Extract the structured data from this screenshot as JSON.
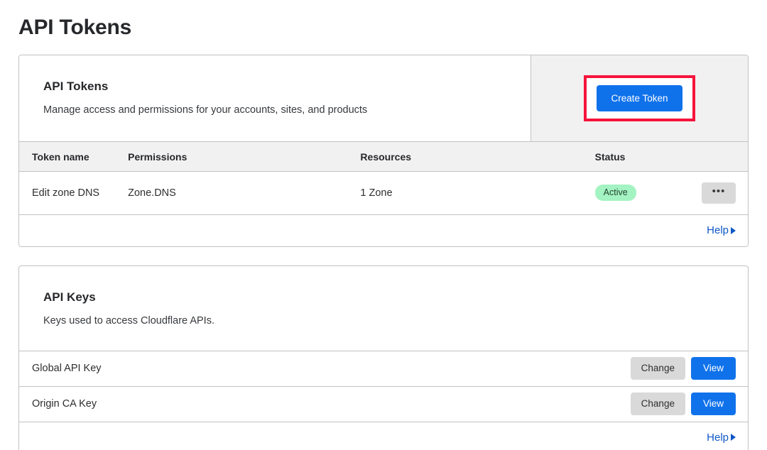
{
  "page": {
    "title": "API Tokens"
  },
  "tokens_card": {
    "header": {
      "title": "API Tokens",
      "subtitle": "Manage access and permissions for your accounts, sites, and products",
      "create_button": "Create Token"
    },
    "table": {
      "columns": [
        "Token name",
        "Permissions",
        "Resources",
        "Status",
        ""
      ],
      "rows": [
        {
          "name": "Edit zone DNS",
          "permissions": "Zone.DNS",
          "resources": "1 Zone",
          "status": "Active",
          "menu": "•••"
        }
      ]
    },
    "help_label": "Help"
  },
  "keys_card": {
    "header": {
      "title": "API Keys",
      "subtitle": "Keys used to access Cloudflare APIs."
    },
    "rows": [
      {
        "label": "Global API Key",
        "change_label": "Change",
        "view_label": "View"
      },
      {
        "label": "Origin CA Key",
        "change_label": "Change",
        "view_label": "View"
      }
    ],
    "help_label": "Help"
  },
  "colors": {
    "primary_blue": "#1072eb",
    "link_blue": "#0d57c6",
    "badge_green": "#a4f3c2",
    "highlight_red": "#f5143c",
    "panel_gray": "#f1f1f1",
    "border_gray": "#c2c2c2",
    "secondary_button_gray": "#d9d9d9"
  }
}
